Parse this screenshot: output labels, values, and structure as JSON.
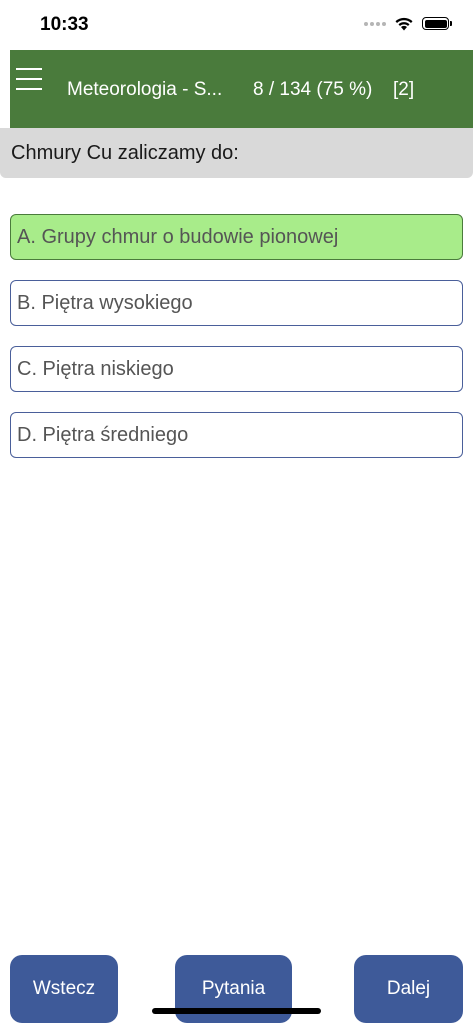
{
  "status_bar": {
    "time": "10:33"
  },
  "header": {
    "title": "Meteorologia - S...",
    "progress": "8 / 134  (75 %)",
    "counter": "[2]",
    "background_color": "#4a7b3c"
  },
  "question": {
    "text": "Chmury Cu zaliczamy do:"
  },
  "answers": [
    {
      "label": "A. Grupy chmur o budowie pionowej",
      "state": "correct"
    },
    {
      "label": "B. Piętra wysokiego",
      "state": "default"
    },
    {
      "label": "C. Piętra niskiego",
      "state": "default"
    },
    {
      "label": "D. Piętra średniego",
      "state": "default"
    }
  ],
  "footer": {
    "back_label": "Wstecz",
    "questions_label": "Pytania",
    "next_label": "Dalej",
    "button_color": "#3e5a99"
  },
  "colors": {
    "correct_answer": "#a8ec8a",
    "question_bar": "#d9d9d9"
  },
  "icons": {
    "menu": "hamburger-menu-icon",
    "wifi": "wifi-icon",
    "battery": "battery-icon",
    "signal": "cellular-signal-icon"
  }
}
